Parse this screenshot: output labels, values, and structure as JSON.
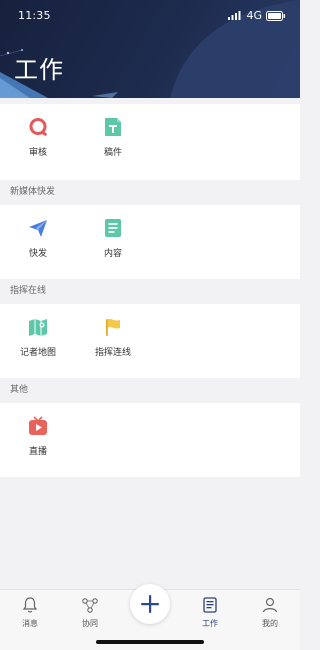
{
  "status_bar": {
    "time": "11:35",
    "network": "4G"
  },
  "header": {
    "title": "工作"
  },
  "sections": [
    {
      "title": "",
      "items": [
        {
          "label": "审核",
          "icon": "review-icon"
        },
        {
          "label": "稿件",
          "icon": "manuscript-icon"
        }
      ]
    },
    {
      "title": "新媒体快发",
      "items": [
        {
          "label": "快发",
          "icon": "send-icon"
        },
        {
          "label": "内容",
          "icon": "content-icon"
        }
      ]
    },
    {
      "title": "指挥在线",
      "items": [
        {
          "label": "记者地图",
          "icon": "reporter-map-icon"
        },
        {
          "label": "指挥连线",
          "icon": "command-flag-icon"
        }
      ]
    },
    {
      "title": "其他",
      "items": [
        {
          "label": "直播",
          "icon": "live-tv-icon"
        }
      ]
    }
  ],
  "tabbar": {
    "items": [
      {
        "label": "消息",
        "icon": "bell-icon"
      },
      {
        "label": "协同",
        "icon": "collaboration-icon"
      },
      {
        "label": "",
        "icon": "plus-icon"
      },
      {
        "label": "工作",
        "icon": "work-icon",
        "active": true
      },
      {
        "label": "我的",
        "icon": "profile-icon"
      }
    ]
  },
  "colors": {
    "header_bg": "#1d2b4e",
    "review_red": "#e5585a",
    "teal": "#5cc8a8",
    "blue": "#4a7fe0",
    "yellow": "#f4c84a",
    "live_red": "#e8635a",
    "tab_active": "#2c3f7a"
  }
}
